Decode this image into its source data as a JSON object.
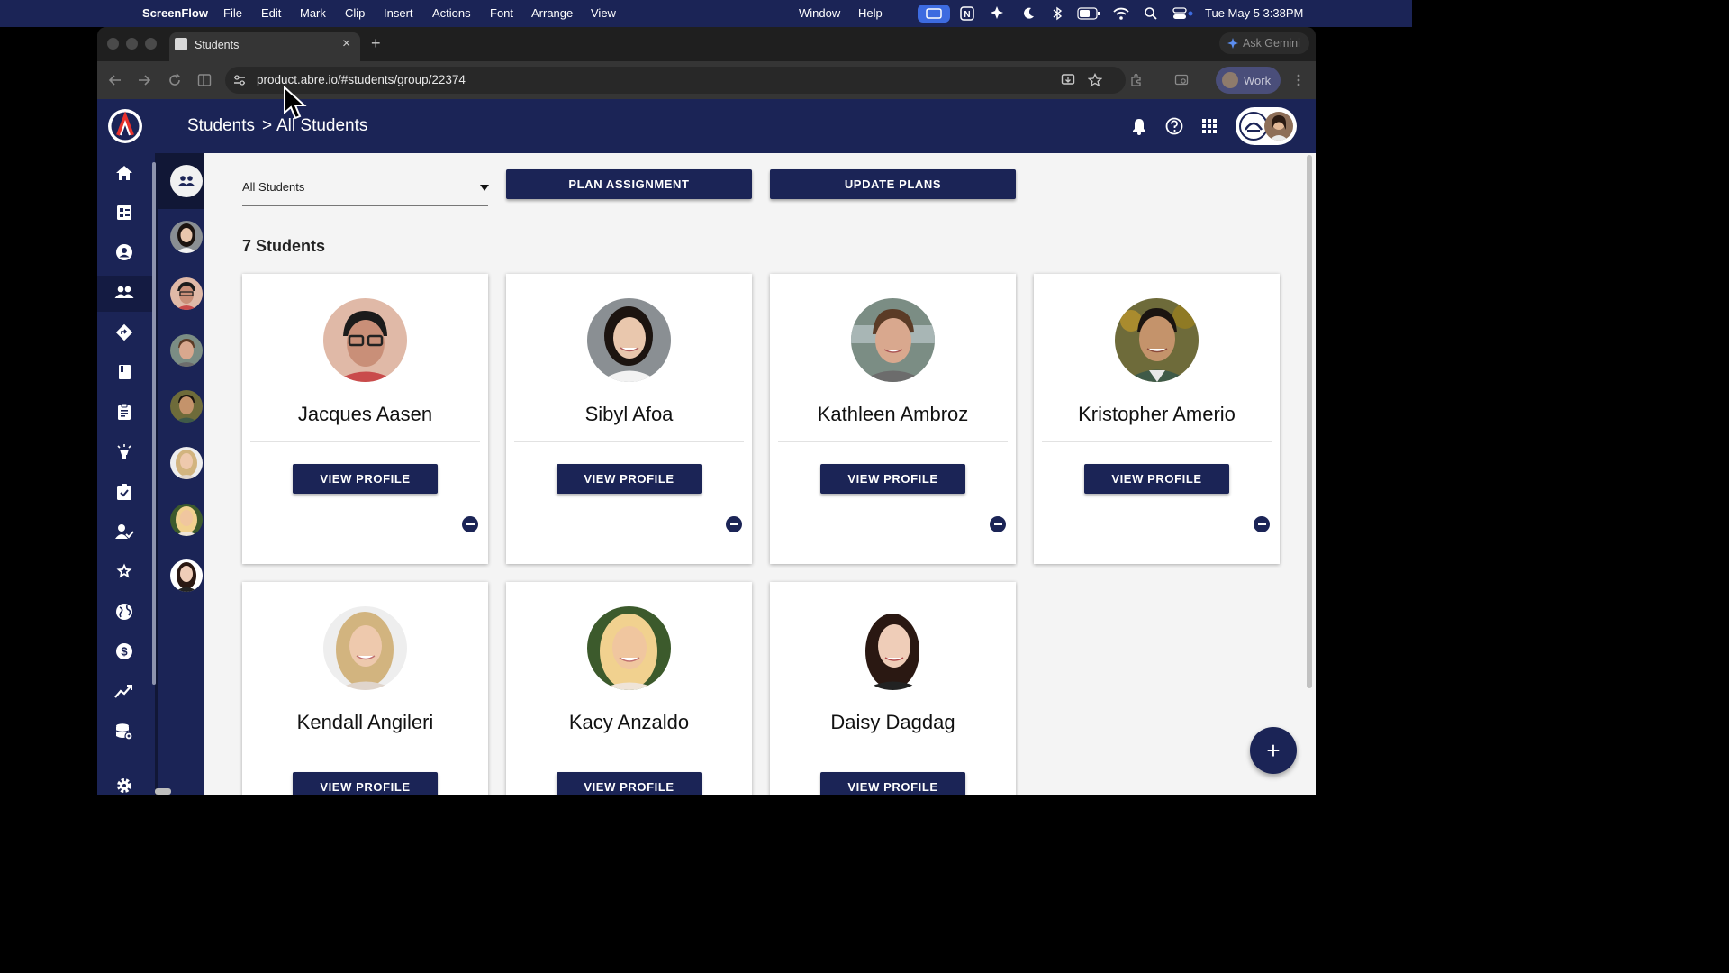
{
  "menubar": {
    "app_name": "ScreenFlow",
    "menus": [
      "File",
      "Edit",
      "Mark",
      "Clip",
      "Insert",
      "Actions",
      "Font",
      "Arrange",
      "View"
    ],
    "right_menus": [
      "Window",
      "Help"
    ],
    "datetime": "Tue May 5  3:38PM"
  },
  "browser": {
    "tab_title": "Students",
    "tab_close": "×",
    "new_tab": "+",
    "ask_gemini": "Ask Gemini",
    "url": "product.abre.io/#students/group/22374",
    "profile_label": "Work"
  },
  "appbar": {
    "breadcrumb_root": "Students",
    "breadcrumb_sep": ">",
    "breadcrumb_current": "All Students"
  },
  "filters": {
    "group_select_value": "All Students",
    "plan_assignment_label": "PLAN ASSIGNMENT",
    "update_plans_label": "UPDATE PLANS"
  },
  "students_count_label": "7 Students",
  "students": [
    {
      "name": "Jacques Aasen",
      "view_label": "VIEW PROFILE",
      "skin": "#c98f78",
      "hair": "#1b1b1b",
      "bg": "#e0b9a7"
    },
    {
      "name": "Sibyl Afoa",
      "view_label": "VIEW PROFILE",
      "skin": "#e9c7ad",
      "hair": "#1c1410",
      "bg": "#8a8f93"
    },
    {
      "name": "Kathleen Ambroz",
      "view_label": "VIEW PROFILE",
      "skin": "#d9a88e",
      "hair": "#5b3b26",
      "bg": "#7b8d84"
    },
    {
      "name": "Kristopher Amerio",
      "view_label": "VIEW PROFILE",
      "skin": "#c4936b",
      "hair": "#1a1410",
      "bg": "#6e6b3a"
    },
    {
      "name": "Kendall Angileri",
      "view_label": "VIEW PROFILE",
      "skin": "#eec9ad",
      "hair": "#d2b47f",
      "bg": "#eeeeee"
    },
    {
      "name": "Kacy Anzaldo",
      "view_label": "VIEW PROFILE",
      "skin": "#f0c69f",
      "hair": "#f1d18f",
      "bg": "#3c5a2c"
    },
    {
      "name": "Daisy Dagdag",
      "view_label": "VIEW PROFILE",
      "skin": "#efcdb8",
      "hair": "#2a1812",
      "bg": "#ffffff"
    }
  ],
  "fab_label": "+",
  "colors": {
    "navy": "#1b2456",
    "content_bg": "#f4f4f4"
  }
}
